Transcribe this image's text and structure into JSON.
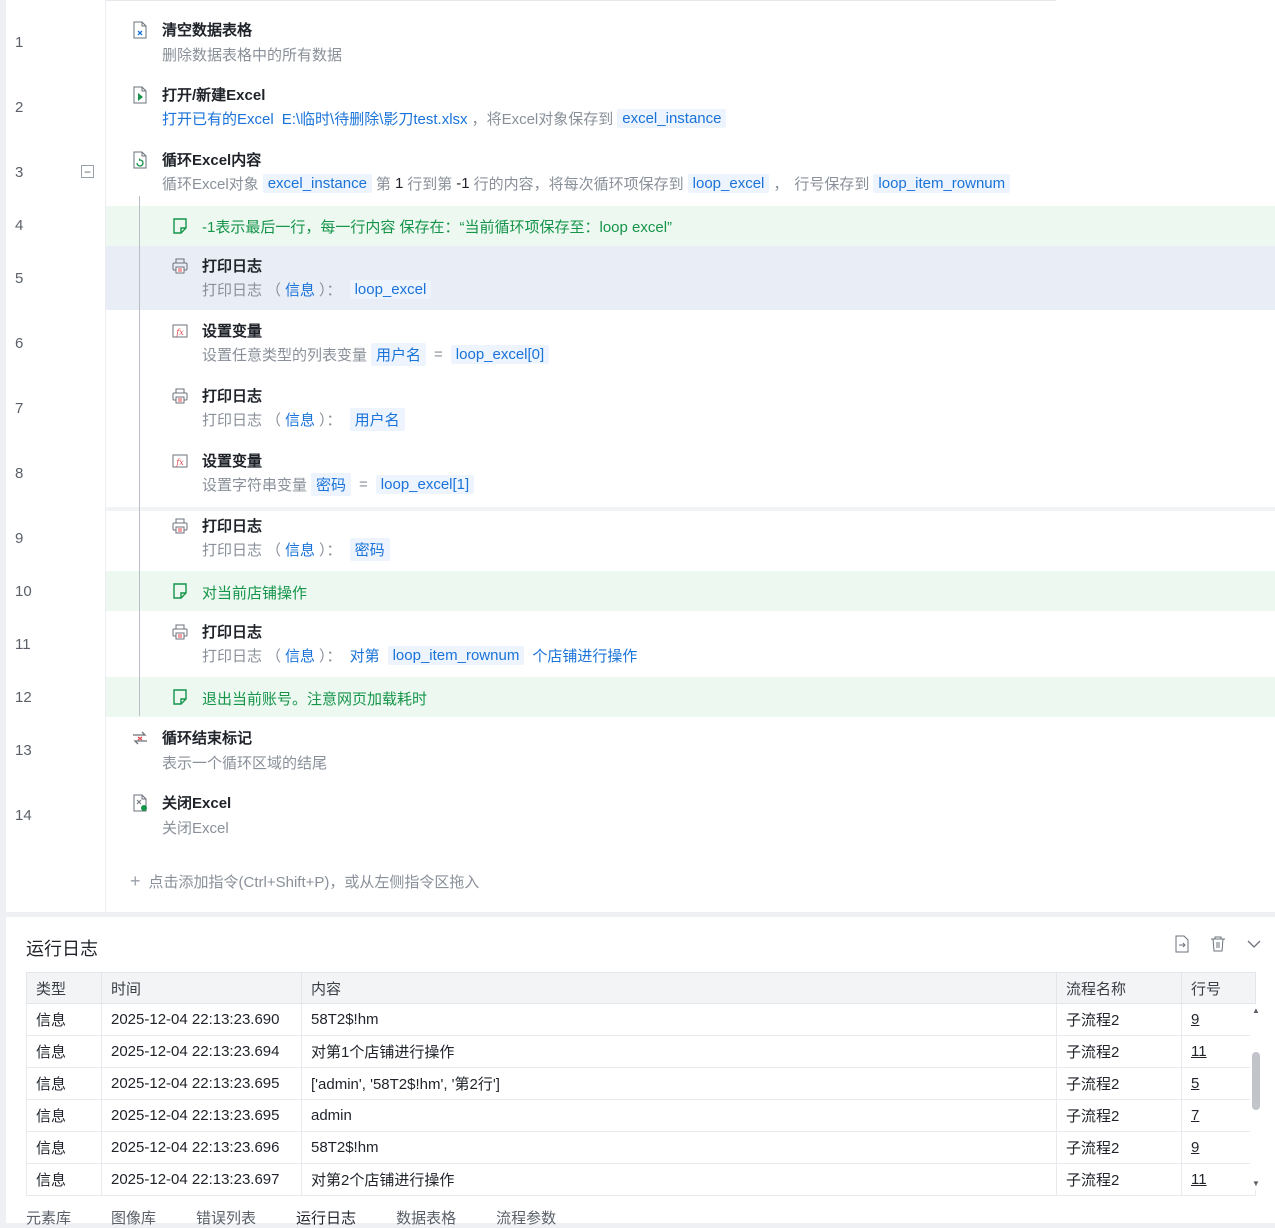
{
  "editor": {
    "line_numbers": [
      "1",
      "2",
      "3",
      "4",
      "5",
      "6",
      "7",
      "8",
      "9",
      "10",
      "11",
      "12",
      "13",
      "14"
    ],
    "steps": {
      "s1": {
        "title": "清空数据表格",
        "desc": "删除数据表格中的所有数据"
      },
      "s2": {
        "title": "打开/新建Excel",
        "a": "打开已有的Excel",
        "b": "E:\\临时\\待删除\\影刀test.xlsx",
        "c": "，",
        "d": "将Excel对象保存到",
        "e": "excel_instance"
      },
      "s3": {
        "title": "循环Excel内容",
        "a": "循环Excel对象",
        "b": "excel_instance",
        "c": "第",
        "d": "1",
        "e": "行到第",
        "f": "-1",
        "g": "行的内容，将每次循环项保存到",
        "h": "loop_excel",
        "i": "，",
        "j": "行号保存到",
        "k": "loop_item_rownum"
      },
      "s4": {
        "comment": "-1表示最后一行，每一行内容 保存在：“当前循环项保存至：loop excel”"
      },
      "s5": {
        "title": "打印日志",
        "a": "打印日志",
        "b": "（",
        "c": "信息",
        "d": "）：",
        "e": "loop_excel"
      },
      "s6": {
        "title": "设置变量",
        "a": "设置任意类型的列表变量",
        "b": "用户名",
        "c": "=",
        "d": "loop_excel[0]"
      },
      "s7": {
        "title": "打印日志",
        "a": "打印日志",
        "b": "（",
        "c": "信息",
        "d": "）：",
        "e": "用户名"
      },
      "s8": {
        "title": "设置变量",
        "a": "设置字符串变量",
        "b": "密码",
        "c": "=",
        "d": "loop_excel[1]"
      },
      "s9": {
        "title": "打印日志",
        "a": "打印日志",
        "b": "（",
        "c": "信息",
        "d": "）：",
        "e": "密码"
      },
      "s10": {
        "comment": "对当前店铺操作"
      },
      "s11": {
        "title": "打印日志",
        "a": "打印日志",
        "b": "（",
        "c": "信息",
        "d": "）：",
        "e": "对第",
        "f": "loop_item_rownum",
        "g": "个店铺进行操作"
      },
      "s12": {
        "comment": "退出当前账号。注意网页加载耗时"
      },
      "s13": {
        "title": "循环结束标记",
        "desc": "表示一个循环区域的结尾"
      },
      "s14": {
        "title": "关闭Excel",
        "desc": "关闭Excel"
      }
    },
    "add_hint": "点击添加指令(Ctrl+Shift+P)，或从左侧指令区拖入"
  },
  "log": {
    "title": "运行日志",
    "columns": [
      "类型",
      "时间",
      "内容",
      "流程名称",
      "行号"
    ],
    "rows": [
      [
        "信息",
        "2025-12-04 22:13:23.690",
        "58T2$!hm",
        "子流程2",
        "9"
      ],
      [
        "信息",
        "2025-12-04 22:13:23.694",
        "对第1个店铺进行操作",
        "子流程2",
        "11"
      ],
      [
        "信息",
        "2025-12-04 22:13:23.695",
        "['admin', '58T2$!hm', '第2行']",
        "子流程2",
        "5"
      ],
      [
        "信息",
        "2025-12-04 22:13:23.695",
        "admin",
        "子流程2",
        "7"
      ],
      [
        "信息",
        "2025-12-04 22:13:23.696",
        "58T2$!hm",
        "子流程2",
        "9"
      ],
      [
        "信息",
        "2025-12-04 22:13:23.697",
        "对第2个店铺进行操作",
        "子流程2",
        "11"
      ]
    ]
  },
  "bottom_tabs": [
    "元素库",
    "图像库",
    "错误列表",
    "运行日志",
    "数据表格",
    "流程参数"
  ],
  "colors": {
    "link": "#1a73d9",
    "comment": "#15944a",
    "highlight": "#e9edf5",
    "comment_bg": "#edf9f0"
  }
}
